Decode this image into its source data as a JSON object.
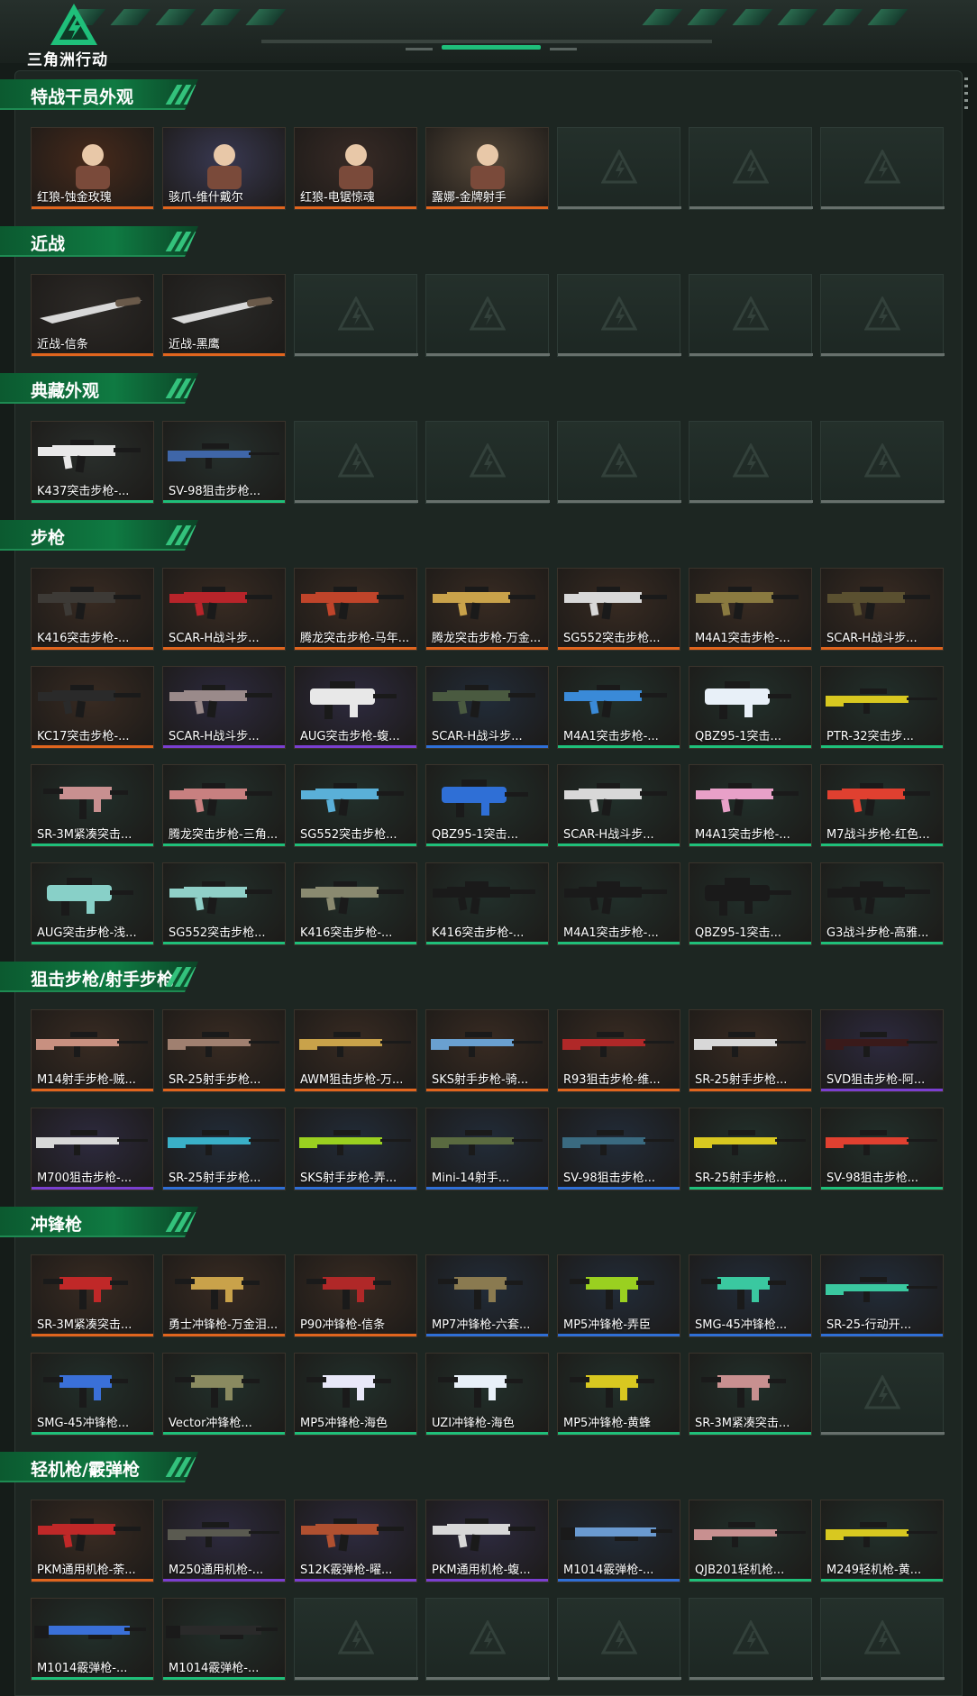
{
  "app": {
    "logo_text": "三角洲行动"
  },
  "colors": {
    "orange": "#e0651e",
    "green": "#1fbf7a",
    "blue": "#2f6fd6",
    "purple": "#7a3fd0",
    "gray": "#67706c"
  },
  "sections": [
    {
      "title": "特战干员外观",
      "items": [
        {
          "name": "红狼-蚀金玫瑰",
          "rarity": "orange",
          "bg": "#4a2a1a",
          "icon": "operator-portrait-icon",
          "tag": "蚀金玫瑰"
        },
        {
          "name": "骇爪-维什戴尔",
          "rarity": "orange",
          "bg": "#3b3a55",
          "icon": "operator-portrait-icon",
          "tag": "维什戴尔"
        },
        {
          "name": "红狼-电锯惊魂",
          "rarity": "orange",
          "bg": "#3a2b26",
          "icon": "operator-portrait-icon",
          "tag": "电锯惊魂"
        },
        {
          "name": "露娜-金牌射手",
          "rarity": "orange",
          "bg": "#5a4a3a",
          "icon": "operator-portrait-icon",
          "tag": ""
        },
        null,
        null,
        null
      ]
    },
    {
      "title": "近战",
      "items": [
        {
          "name": "近战-信条",
          "rarity": "orange",
          "bg": "#2e2a27",
          "icon": "knife-icon"
        },
        {
          "name": "近战-黑鹰",
          "rarity": "orange",
          "bg": "#2b2a28",
          "icon": "knife-icon"
        },
        null,
        null,
        null,
        null,
        null
      ]
    },
    {
      "title": "典藏外观",
      "items": [
        {
          "name": "K437突击步枪-...",
          "rarity": "green",
          "bg": "#2a2f2c",
          "icon": "rifle-icon",
          "gun": "#e8e8e8"
        },
        {
          "name": "SV-98狙击步枪...",
          "rarity": "green",
          "bg": "#26302d",
          "icon": "sniper-icon",
          "gun": "#3f66a8"
        },
        null,
        null,
        null,
        null,
        null
      ]
    },
    {
      "title": "步枪",
      "items": [
        {
          "name": "K416突击步枪-...",
          "rarity": "orange",
          "bg": "#3a2b22",
          "icon": "rifle-icon",
          "gun": "#3d3a36"
        },
        {
          "name": "SCAR-H战斗步...",
          "rarity": "orange",
          "bg": "#3a2b22",
          "icon": "rifle-icon",
          "gun": "#b8242a"
        },
        {
          "name": "腾龙突击步枪-马年...",
          "rarity": "orange",
          "bg": "#3a2b22",
          "icon": "rifle-icon",
          "gun": "#c0442a"
        },
        {
          "name": "腾龙突击步枪-万金...",
          "rarity": "orange",
          "bg": "#3a2b22",
          "icon": "rifle-icon",
          "gun": "#c9a24a"
        },
        {
          "name": "SG552突击步枪...",
          "rarity": "orange",
          "bg": "#3a2b22",
          "icon": "rifle-icon",
          "gun": "#d8d8d8"
        },
        {
          "name": "M4A1突击步枪-...",
          "rarity": "orange",
          "bg": "#3a2b22",
          "icon": "rifle-icon",
          "gun": "#8a7a40"
        },
        {
          "name": "SCAR-H战斗步...",
          "rarity": "orange",
          "bg": "#3a2b22",
          "icon": "rifle-icon",
          "gun": "#5a5030"
        },
        {
          "name": "KC17突击步枪-...",
          "rarity": "orange",
          "bg": "#3a2b22",
          "icon": "rifle-icon",
          "gun": "#2a2a2a"
        },
        {
          "name": "SCAR-H战斗步...",
          "rarity": "purple",
          "bg": "#2e2a40",
          "icon": "rifle-icon",
          "gun": "#9a8a8a"
        },
        {
          "name": "AUG突击步枪-蝮...",
          "rarity": "purple",
          "bg": "#2e2a40",
          "icon": "bullpup-icon",
          "gun": "#e8e8e8"
        },
        {
          "name": "SCAR-H战斗步...",
          "rarity": "blue",
          "bg": "#222c3a",
          "icon": "rifle-icon",
          "gun": "#4a5a40"
        },
        {
          "name": "M4A1突击步枪-...",
          "rarity": "green",
          "bg": "#22302b",
          "icon": "rifle-icon",
          "gun": "#3a8ad8"
        },
        {
          "name": "QBZ95-1突击...",
          "rarity": "green",
          "bg": "#22302b",
          "icon": "bullpup-icon",
          "gun": "#e8f0f8"
        },
        {
          "name": "PTR-32突击步...",
          "rarity": "green",
          "bg": "#22302b",
          "icon": "sniper-icon",
          "gun": "#d8c820"
        },
        {
          "name": "SR-3M紧凑突击...",
          "rarity": "green",
          "bg": "#22302b",
          "icon": "smg-icon",
          "gun": "#c89090"
        },
        {
          "name": "腾龙突击步枪-三角...",
          "rarity": "green",
          "bg": "#22302b",
          "icon": "rifle-icon",
          "gun": "#c88080"
        },
        {
          "name": "SG552突击步枪...",
          "rarity": "green",
          "bg": "#22302b",
          "icon": "rifle-icon",
          "gun": "#5ab0d8"
        },
        {
          "name": "QBZ95-1突击...",
          "rarity": "green",
          "bg": "#22302b",
          "icon": "bullpup-icon",
          "gun": "#2f6fd6"
        },
        {
          "name": "SCAR-H战斗步...",
          "rarity": "green",
          "bg": "#22302b",
          "icon": "rifle-icon",
          "gun": "#d8d8d8"
        },
        {
          "name": "M4A1突击步枪-...",
          "rarity": "green",
          "bg": "#22302b",
          "icon": "rifle-icon",
          "gun": "#e8a0c8"
        },
        {
          "name": "M7战斗步枪-红色...",
          "rarity": "green",
          "bg": "#22302b",
          "icon": "rifle-icon",
          "gun": "#e04030"
        },
        {
          "name": "AUG突击步枪-浅...",
          "rarity": "green",
          "bg": "#22302b",
          "icon": "bullpup-icon",
          "gun": "#88d0c8"
        },
        {
          "name": "SG552突击步枪...",
          "rarity": "green",
          "bg": "#22302b",
          "icon": "rifle-icon",
          "gun": "#90d0c8"
        },
        {
          "name": "K416突击步枪-...",
          "rarity": "green",
          "bg": "#22302b",
          "icon": "rifle-icon",
          "gun": "#8a8a70"
        },
        {
          "name": "K416突击步枪-...",
          "rarity": "green",
          "bg": "#22302b",
          "icon": "rifle-icon",
          "gun": "#1a1a1a"
        },
        {
          "name": "M4A1突击步枪-...",
          "rarity": "green",
          "bg": "#22302b",
          "icon": "rifle-icon",
          "gun": "#1a1a1a"
        },
        {
          "name": "QBZ95-1突击...",
          "rarity": "green",
          "bg": "#22302b",
          "icon": "bullpup-icon",
          "gun": "#1a1a1a"
        },
        {
          "name": "G3战斗步枪-高雅...",
          "rarity": "green",
          "bg": "#22302b",
          "icon": "rifle-icon",
          "gun": "#1a1a1a"
        }
      ]
    },
    {
      "title": "狙击步枪/射手步枪",
      "items": [
        {
          "name": "M14射手步枪-贼...",
          "rarity": "orange",
          "bg": "#3a2b22",
          "icon": "sniper-icon",
          "gun": "#c89080"
        },
        {
          "name": "SR-25射手步枪...",
          "rarity": "orange",
          "bg": "#3a2b22",
          "icon": "sniper-icon",
          "gun": "#a08070"
        },
        {
          "name": "AWM狙击步枪-万...",
          "rarity": "orange",
          "bg": "#3a2b22",
          "icon": "sniper-icon",
          "gun": "#c9a24a"
        },
        {
          "name": "SKS射手步枪-骑...",
          "rarity": "orange",
          "bg": "#3a2b22",
          "icon": "sniper-icon",
          "gun": "#6aa0d0"
        },
        {
          "name": "R93狙击步枪-维...",
          "rarity": "orange",
          "bg": "#3a2b22",
          "icon": "sniper-icon",
          "gun": "#b02828"
        },
        {
          "name": "SR-25射手步枪...",
          "rarity": "orange",
          "bg": "#3a2b22",
          "icon": "sniper-icon",
          "gun": "#d8d8d8"
        },
        {
          "name": "SVD狙击步枪-阿...",
          "rarity": "purple",
          "bg": "#2e2a40",
          "icon": "sniper-icon",
          "gun": "#3a1a1a"
        },
        {
          "name": "M700狙击步枪-...",
          "rarity": "purple",
          "bg": "#2e2a40",
          "icon": "sniper-icon",
          "gun": "#d8d8d8"
        },
        {
          "name": "SR-25射手步枪...",
          "rarity": "blue",
          "bg": "#222c3a",
          "icon": "sniper-icon",
          "gun": "#3ab0c8"
        },
        {
          "name": "SKS射手步枪-弄...",
          "rarity": "blue",
          "bg": "#222c3a",
          "icon": "sniper-icon",
          "gun": "#9ad020"
        },
        {
          "name": "Mini-14射手...",
          "rarity": "blue",
          "bg": "#222c3a",
          "icon": "sniper-icon",
          "gun": "#5a6a40"
        },
        {
          "name": "SV-98狙击步枪...",
          "rarity": "blue",
          "bg": "#222c3a",
          "icon": "sniper-icon",
          "gun": "#3a6a80"
        },
        {
          "name": "SR-25射手步枪...",
          "rarity": "green",
          "bg": "#22302b",
          "icon": "sniper-icon",
          "gun": "#d8c820"
        },
        {
          "name": "SV-98狙击步枪...",
          "rarity": "green",
          "bg": "#22302b",
          "icon": "sniper-icon",
          "gun": "#e04030"
        }
      ]
    },
    {
      "title": "冲锋枪",
      "items": [
        {
          "name": "SR-3M紧凑突击...",
          "rarity": "orange",
          "bg": "#3a2b22",
          "icon": "smg-icon",
          "gun": "#c02828"
        },
        {
          "name": "勇士冲锋枪-万金泪...",
          "rarity": "orange",
          "bg": "#3a2b22",
          "icon": "smg-icon",
          "gun": "#c9a24a"
        },
        {
          "name": "P90冲锋枪-信条",
          "rarity": "orange",
          "bg": "#3a2b22",
          "icon": "smg-icon",
          "gun": "#b02828"
        },
        {
          "name": "MP7冲锋枪-六套...",
          "rarity": "blue",
          "bg": "#222c3a",
          "icon": "smg-icon",
          "gun": "#8a7a50"
        },
        {
          "name": "MP5冲锋枪-弄臣",
          "rarity": "blue",
          "bg": "#222c3a",
          "icon": "smg-icon",
          "gun": "#9ad020"
        },
        {
          "name": "SMG-45冲锋枪...",
          "rarity": "blue",
          "bg": "#222c3a",
          "icon": "smg-icon",
          "gun": "#3ac8a0"
        },
        {
          "name": "SR-25-行动开...",
          "rarity": "blue",
          "bg": "#222c3a",
          "icon": "sniper-icon",
          "gun": "#3ac8a0"
        },
        {
          "name": "SMG-45冲锋枪...",
          "rarity": "green",
          "bg": "#22302b",
          "icon": "smg-icon",
          "gun": "#3a70d8"
        },
        {
          "name": "Vector冲锋枪...",
          "rarity": "green",
          "bg": "#22302b",
          "icon": "smg-icon",
          "gun": "#8a8a60"
        },
        {
          "name": "MP5冲锋枪-海色",
          "rarity": "green",
          "bg": "#22302b",
          "icon": "smg-icon",
          "gun": "#e8e8f8"
        },
        {
          "name": "UZI冲锋枪-海色",
          "rarity": "green",
          "bg": "#22302b",
          "icon": "smg-icon",
          "gun": "#e8f0f8"
        },
        {
          "name": "MP5冲锋枪-黄蜂",
          "rarity": "green",
          "bg": "#22302b",
          "icon": "smg-icon",
          "gun": "#d8c820"
        },
        {
          "name": "SR-3M紧凑突击...",
          "rarity": "green",
          "bg": "#22302b",
          "icon": "smg-icon",
          "gun": "#c89090"
        },
        null
      ]
    },
    {
      "title": "轻机枪/霰弹枪",
      "items": [
        {
          "name": "PKM通用机枪-荼...",
          "rarity": "orange",
          "bg": "#3a2b22",
          "icon": "rifle-icon",
          "gun": "#c02828"
        },
        {
          "name": "M250通用机枪-...",
          "rarity": "purple",
          "bg": "#2e2a40",
          "icon": "sniper-icon",
          "gun": "#5a5a50"
        },
        {
          "name": "S12K霰弹枪-曜...",
          "rarity": "purple",
          "bg": "#2e2a40",
          "icon": "rifle-icon",
          "gun": "#b05030"
        },
        {
          "name": "PKM通用机枪-蝮...",
          "rarity": "purple",
          "bg": "#2e2a40",
          "icon": "rifle-icon",
          "gun": "#d8d8d8"
        },
        {
          "name": "M1014霰弹枪-...",
          "rarity": "blue",
          "bg": "#222c3a",
          "icon": "shotgun-icon",
          "gun": "#6a9ad0"
        },
        {
          "name": "QJB201轻机枪...",
          "rarity": "green",
          "bg": "#22302b",
          "icon": "sniper-icon",
          "gun": "#c89090"
        },
        {
          "name": "M249轻机枪-黄...",
          "rarity": "green",
          "bg": "#22302b",
          "icon": "sniper-icon",
          "gun": "#d8c820"
        },
        {
          "name": "M1014霰弹枪-...",
          "rarity": "green",
          "bg": "#22302b",
          "icon": "shotgun-icon",
          "gun": "#3a70d8"
        },
        {
          "name": "M1014霰弹枪-...",
          "rarity": "green",
          "bg": "#22302b",
          "icon": "shotgun-icon",
          "gun": "#2a2a2a"
        },
        null,
        null,
        null,
        null,
        null
      ]
    }
  ]
}
